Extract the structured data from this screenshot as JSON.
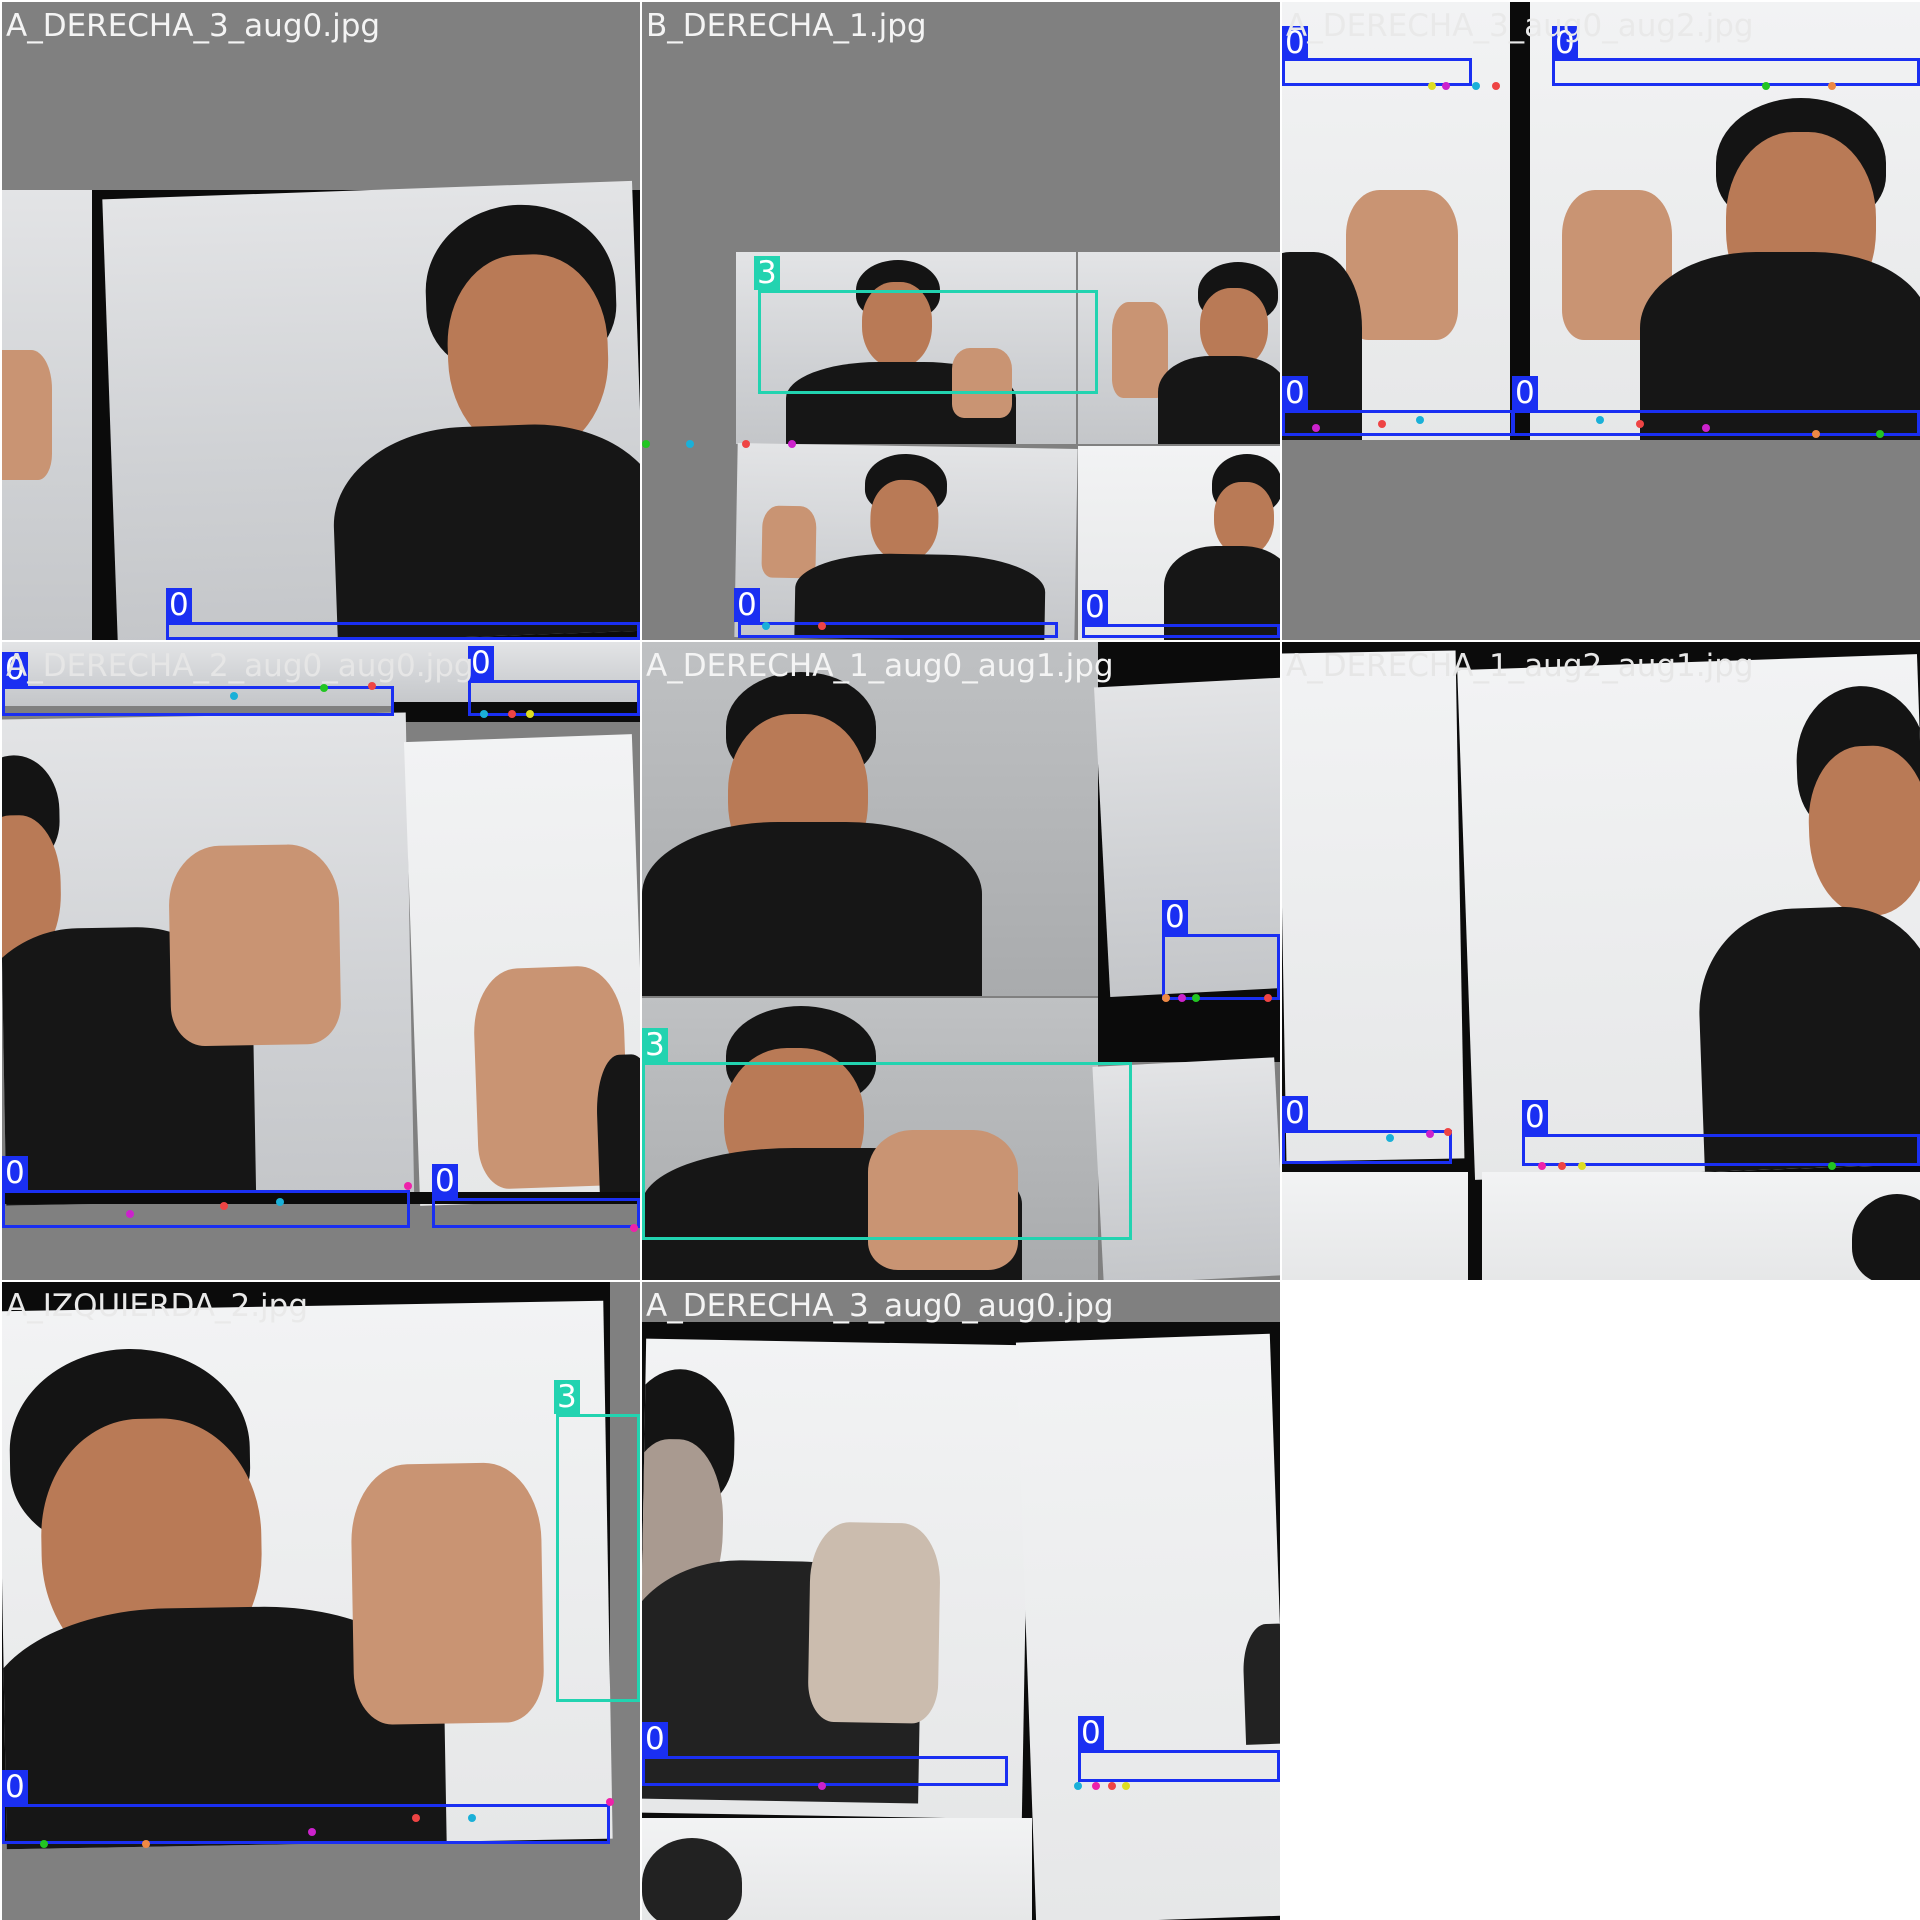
{
  "mosaic": {
    "tiles": [
      {
        "title": "A_DERECHA_3_aug0.jpg",
        "labels": [
          "0"
        ]
      },
      {
        "title": "B_DERECHA_1.jpg",
        "labels": [
          "3",
          "0",
          "0"
        ]
      },
      {
        "title": "A_DERECHA_3_aug0_aug2.jpg",
        "labels": [
          "0",
          "0",
          "0",
          "0"
        ]
      },
      {
        "title": "A_DERECHA_2_aug0_aug0.jpg",
        "labels": [
          "0",
          "0",
          "0",
          "0"
        ]
      },
      {
        "title": "A_DERECHA_1_aug0_aug1.jpg",
        "labels": [
          "0",
          "3"
        ]
      },
      {
        "title": "A_DERECHA_1_aug2_aug1.jpg",
        "labels": [
          "0",
          "0"
        ]
      },
      {
        "title": "A_IZQUIERDA_2.jpg",
        "labels": [
          "3",
          "0"
        ]
      },
      {
        "title": "A_DERECHA_3_aug0_aug0.jpg",
        "labels": [
          "0",
          "0"
        ]
      }
    ]
  },
  "colors": {
    "class_0_box": "#1a2ff2",
    "class_3_box": "#22d3b0",
    "pad_gray": "#808080",
    "background": "#ffffff"
  }
}
